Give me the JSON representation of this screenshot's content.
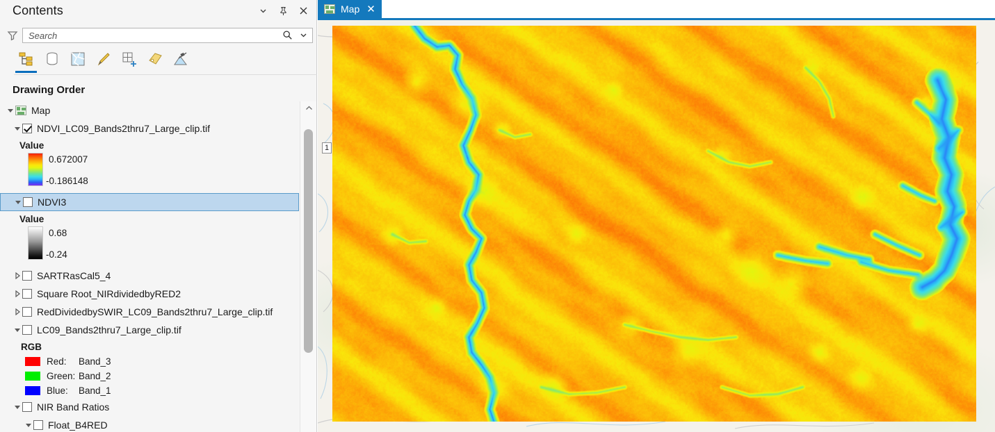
{
  "panel": {
    "title": "Contents",
    "header_buttons": [
      {
        "name": "chevron-down-icon",
        "label": "⌄"
      },
      {
        "name": "pin-icon",
        "label": "⚐"
      },
      {
        "name": "close-icon",
        "label": "✕"
      }
    ],
    "search": {
      "placeholder": "Search",
      "value": ""
    },
    "toolbar": [
      {
        "name": "drawing-order-tab",
        "label": "Drawing Order",
        "active": true
      },
      {
        "name": "data-source-tab",
        "label": "List By Data Source",
        "active": false
      },
      {
        "name": "snapping-tab",
        "label": "List By Snapping",
        "active": false
      },
      {
        "name": "editing-tab",
        "label": "List By Editing",
        "active": false
      },
      {
        "name": "selection-tab",
        "label": "List By Selection",
        "active": false
      },
      {
        "name": "labeling-tab",
        "label": "List By Labeling",
        "active": false
      },
      {
        "name": "charts-tab",
        "label": "List By Charts",
        "active": false
      }
    ],
    "section_label": "Drawing Order",
    "scroll": {
      "thumb_top_pct": 4,
      "thumb_height_pct": 71
    }
  },
  "tree": {
    "map_group": {
      "label": "Map",
      "expanded": true
    },
    "layers": [
      {
        "name": "ndvi-clip-layer",
        "label": "NDVI_LC09_Bands2thru7_Large_clip.tif",
        "checked": true,
        "expanded": true,
        "selected": false,
        "legend": {
          "title": "Value",
          "ramp": "rainbow",
          "high": "0.672007",
          "low": "-0.186148"
        }
      },
      {
        "name": "ndvi3-layer",
        "label": "NDVI3",
        "checked": false,
        "expanded": true,
        "selected": true,
        "legend": {
          "title": "Value",
          "ramp": "gray",
          "high": "0.68",
          "low": "-0.24"
        }
      },
      {
        "name": "sartrascal5-4-layer",
        "label": "SARTRasCal5_4",
        "checked": false,
        "expanded": false,
        "selected": false
      },
      {
        "name": "square-root-nir-red2-layer",
        "label": "Square Root_NIRdividedbyRED2",
        "checked": false,
        "expanded": false,
        "selected": false
      },
      {
        "name": "red-divided-by-swir-layer",
        "label": "RedDividedbySWIR_LC09_Bands2thru7_Large_clip.tif",
        "checked": false,
        "expanded": false,
        "selected": false
      },
      {
        "name": "lc09-bands-clip-layer",
        "label": "LC09_Bands2thru7_Large_clip.tif",
        "checked": false,
        "expanded": true,
        "selected": false,
        "rgb": {
          "title": "RGB",
          "channels": [
            {
              "name": "Red:",
              "band": "Band_3",
              "color": "#ff0000"
            },
            {
              "name": "Green:",
              "band": "Band_2",
              "color": "#00ee00"
            },
            {
              "name": "Blue:",
              "band": "Band_1",
              "color": "#0000ff"
            }
          ]
        }
      },
      {
        "name": "nir-band-ratios-group",
        "label": "NIR Band Ratios",
        "checked": false,
        "expanded": true,
        "selected": false
      },
      {
        "name": "float-b4red-layer",
        "label": "Float_B4RED",
        "checked": false,
        "expanded": true,
        "selected": false,
        "indent": true
      }
    ]
  },
  "map": {
    "tab": {
      "label": "Map",
      "close": "✕",
      "active": true
    },
    "basemap_labels": [
      {
        "name": "highway-shield",
        "text": "1"
      }
    ]
  },
  "colors": {
    "accent": "#1479bd",
    "selection": "#bdd7ee",
    "panel_bg": "#f5f5f5"
  }
}
